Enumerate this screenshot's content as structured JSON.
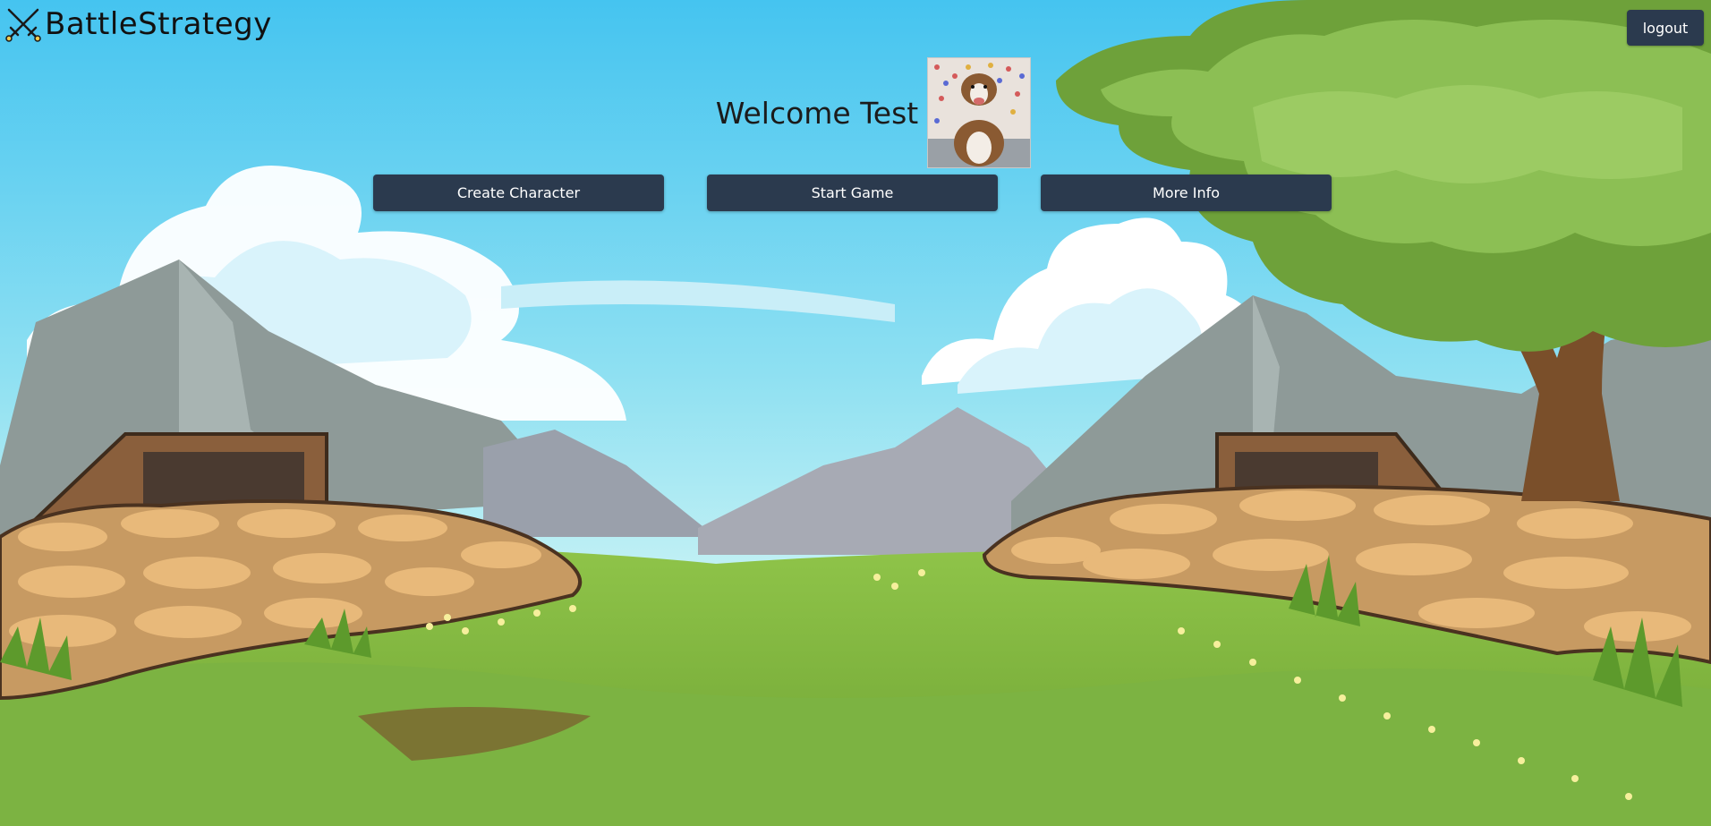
{
  "app": {
    "brand_name": "BattleStrategy",
    "brand_icon": "crossed-swords-icon"
  },
  "header": {
    "logout_label": "logout"
  },
  "welcome": {
    "text": "Welcome Test",
    "avatar": "dog-photo-avatar"
  },
  "actions": {
    "create_character": "Create Character",
    "start_game": "Start Game",
    "more_info": "More Info"
  },
  "colors": {
    "button_bg": "#2b3a4e",
    "button_text": "#ffffff",
    "sky": "#4fc3f0",
    "grass": "#7cb342"
  }
}
